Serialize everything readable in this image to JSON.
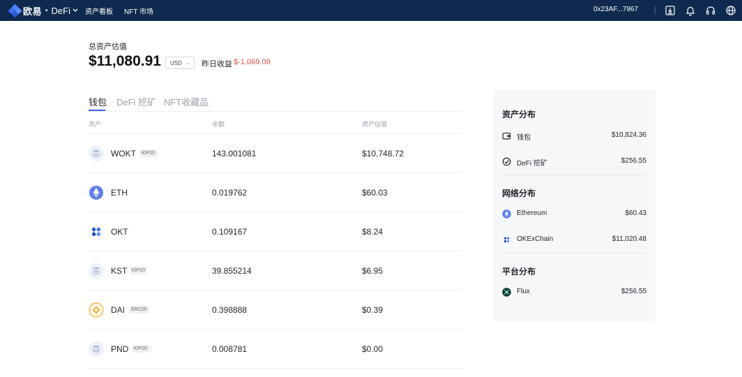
{
  "nav": {
    "brand": "欧易",
    "product": "DeFi",
    "links": [
      "资产看板",
      "NFT 市场"
    ],
    "address": "0x23AF...7967",
    "icons": [
      "download-icon",
      "bell-icon",
      "headset-icon",
      "globe-icon"
    ]
  },
  "summary": {
    "label": "总资产估值",
    "total": "$11,080.91",
    "currency": "USD",
    "yesterday_label": "昨日收益",
    "yesterday_value": "$-1,069.09"
  },
  "tabs": [
    {
      "label": "钱包",
      "active": true
    },
    {
      "label": "DeFi 挖矿",
      "active": false
    },
    {
      "label": "NFT收藏品",
      "active": false
    }
  ],
  "table": {
    "headers": [
      "资产",
      "余额",
      "资产估值"
    ],
    "rows": [
      {
        "symbol": "WOKT",
        "tag": "KIP20",
        "balance": "143.001081",
        "value": "$10,748.72",
        "icon": "token-stack-icon"
      },
      {
        "symbol": "ETH",
        "tag": "",
        "balance": "0.019762",
        "value": "$60.03",
        "icon": "ethereum-icon"
      },
      {
        "symbol": "OKT",
        "tag": "",
        "balance": "0.109167",
        "value": "$8.24",
        "icon": "okt-icon"
      },
      {
        "symbol": "KST",
        "tag": "KIP20",
        "balance": "39.855214",
        "value": "$6.95",
        "icon": "token-stack-icon"
      },
      {
        "symbol": "DAI",
        "tag": "ERC20",
        "balance": "0.398888",
        "value": "$0.39",
        "icon": "dai-icon"
      },
      {
        "symbol": "PND",
        "tag": "KIP20",
        "balance": "0.008781",
        "value": "$0.00",
        "icon": "token-stack-icon"
      }
    ]
  },
  "panel": {
    "asset_title": "资产分布",
    "asset_items": [
      {
        "label": "钱包",
        "value": "$10,824.36",
        "icon": "wallet-icon"
      },
      {
        "label": "DeFi 挖矿",
        "value": "$256.55",
        "icon": "gauge-icon"
      }
    ],
    "network_title": "网络分布",
    "network_items": [
      {
        "label": "Ethereum",
        "value": "$60.43",
        "icon": "ethereum-icon"
      },
      {
        "label": "OKExChain",
        "value": "$11,020.48",
        "icon": "okt-icon"
      }
    ],
    "platform_title": "平台分布",
    "platform_items": [
      {
        "label": "Flux",
        "value": "$256.55",
        "icon": "flux-icon"
      }
    ]
  },
  "colors": {
    "nav_bg": "#0f2a4e",
    "accent": "#3b5bdb",
    "loss": "#e04d4d",
    "panel_bg": "#f6f7f9"
  }
}
